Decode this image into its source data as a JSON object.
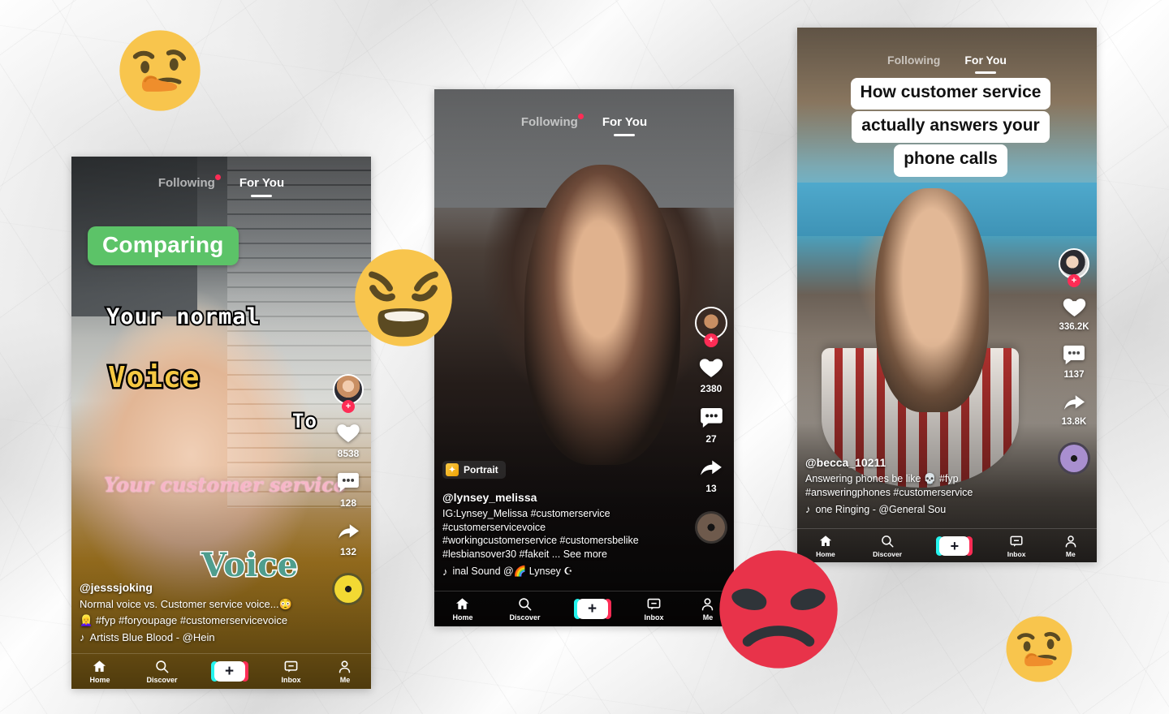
{
  "background": {
    "texture": "crumpled-paper",
    "color": "#ededed"
  },
  "theme": {
    "tiktok_red": "#fe2c55",
    "tiktok_cyan": "#25f4ee",
    "green_pill": "#5cc368",
    "emoji_yellow": "#f8c54d",
    "emoji_red": "#e8334a"
  },
  "nav": {
    "items": [
      {
        "label": "Home",
        "icon": "home-icon"
      },
      {
        "label": "Discover",
        "icon": "search-icon"
      },
      {
        "label": "",
        "icon": "create-plus-icon"
      },
      {
        "label": "Inbox",
        "icon": "inbox-icon"
      },
      {
        "label": "Me",
        "icon": "person-icon"
      }
    ],
    "create_plus": "+"
  },
  "tabs": {
    "following": "Following",
    "for_you": "For You"
  },
  "phones": [
    {
      "id": "phone-left",
      "creator": "@jesssjoking",
      "tabs": {
        "following": "Following",
        "for_you": "For You",
        "active": "For You",
        "has_badge": true
      },
      "overlays": {
        "pill": "Comparing",
        "line1": "Your  normal",
        "line2": "Voice",
        "line3": "To",
        "line4": "Your customer service",
        "line5": "Voice"
      },
      "caption": {
        "description": "Normal voice vs. Customer service voice...😳",
        "hashtag_prefix_emoji": "👱‍♀️",
        "hashtags": "#fyp #foryoupage #customerservicevoice",
        "music": "Artists   Blue Blood - @Hein"
      },
      "actions": {
        "likes": "8538",
        "comments": "128",
        "shares": "132"
      }
    },
    {
      "id": "phone-center",
      "creator": "@lynsey_melissa",
      "tabs": {
        "following": "Following",
        "for_you": "For You",
        "active": "For You",
        "has_badge": true
      },
      "filter_chip": "Portrait",
      "caption": {
        "description_line1": "IG:Lynsey_Melissa #customerservice",
        "description_line2": "#customerservicevoice",
        "description_line3": "#workingcustomerservice #customersbelike",
        "description_line4": "#lesbiansover30 #fakeit ... See more",
        "see_more": "See more",
        "music": "inal Sound    @🌈 Lynsey ☪"
      },
      "actions": {
        "likes": "2380",
        "comments": "27",
        "shares": "13"
      }
    },
    {
      "id": "phone-right",
      "creator": "@becca_10211",
      "tabs": {
        "following": "Following",
        "for_you": "For You",
        "active": "For You",
        "has_badge": false
      },
      "overlays": {
        "title_line1": "How customer service",
        "title_line2": "actually answers your",
        "title_line3": "phone calls"
      },
      "caption": {
        "description_line1": "Answering phones be like 💀 #fyp",
        "description_line2": "#answeringphones #customerservice",
        "music": "one Ringing - @General Sou"
      },
      "actions": {
        "likes": "336.2K",
        "comments": "1137",
        "shares": "13.8K"
      }
    }
  ],
  "emojis": [
    {
      "name": "thinking-face-emoji",
      "kind": "thinking",
      "label": "🤔"
    },
    {
      "name": "weary-face-emoji",
      "kind": "weary",
      "label": "😩"
    },
    {
      "name": "angry-face-emoji",
      "kind": "angry",
      "label": "😡"
    },
    {
      "name": "thinking-face-emoji-2",
      "kind": "thinking",
      "label": "🤔"
    }
  ]
}
